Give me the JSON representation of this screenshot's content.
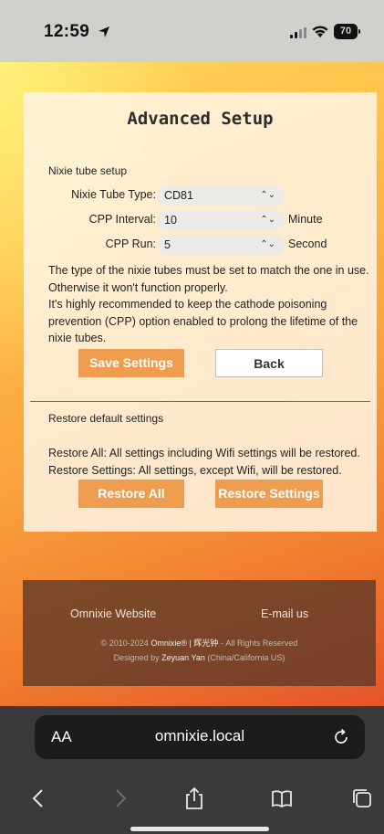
{
  "status_bar": {
    "time": "12:59",
    "battery": "70",
    "icons": [
      "location-arrow-icon",
      "signal-icon",
      "wifi-icon",
      "battery-icon"
    ]
  },
  "panel": {
    "title": "Advanced Setup",
    "nixie_section_label": "Nixie tube setup",
    "fields": {
      "tube_type": {
        "label": "Nixie Tube Type:",
        "value": "CD81"
      },
      "cpp_interval": {
        "label": "CPP Interval:",
        "value": "10",
        "unit": "Minute"
      },
      "cpp_run": {
        "label": "CPP Run:",
        "value": "5",
        "unit": "Second"
      }
    },
    "description_1": "The type of the nixie tubes must be set to match the one in use. Otherwise it won't function properly.",
    "description_2": "It's highly recommended to keep the cathode poisoning prevention (CPP) option enabled to prolong the lifetime of the nixie tubes.",
    "save_button": "Save Settings",
    "back_button": "Back",
    "restore_section_label": "Restore default settings",
    "restore_all_desc": "Restore All: All settings including Wifi settings will be restored.",
    "restore_settings_desc": "Restore Settings: All settings, except Wifi, will be restored.",
    "restore_all_button": "Restore All",
    "restore_settings_button": "Restore Settings"
  },
  "footer": {
    "website_link": "Omnixie Website",
    "email_link": "E-mail us",
    "copyright_prefix": "© 2010-2024",
    "brand": "Omnixie® | 辉光钟",
    "copyright_suffix": "- All Rights Reserved",
    "designed_by_prefix": "Designed by",
    "designer": "Zeyuan Yan",
    "designer_location": "(China/California US)"
  },
  "browser": {
    "aa_label": "AA",
    "url": "omnixie.local",
    "toolbar_icons": [
      "back-icon",
      "forward-icon",
      "share-icon",
      "bookmarks-icon",
      "tabs-icon"
    ]
  },
  "colors": {
    "accent_button": "#ee9d4e",
    "page_gradient": [
      "#ffd75a",
      "#f9a23e",
      "#e4552a"
    ],
    "footer_bg": "#5a3728",
    "browser_chrome": "#3a3a3c"
  }
}
